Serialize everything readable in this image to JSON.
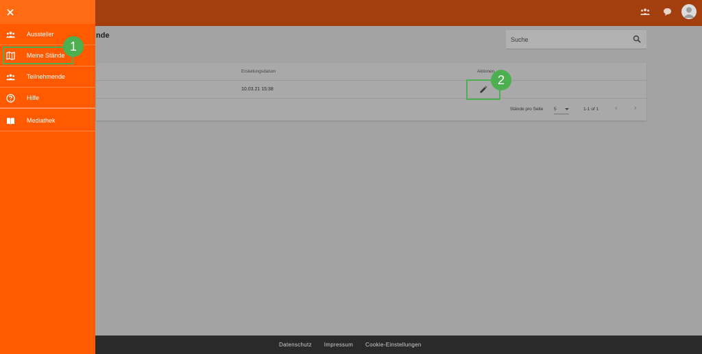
{
  "sidebar": {
    "items": [
      {
        "label": "Aussteller",
        "icon": "people-icon"
      },
      {
        "label": "Meine Stände",
        "icon": "map-icon"
      },
      {
        "label": "Teilnehmende",
        "icon": "people-icon"
      },
      {
        "label": "Hilfe",
        "icon": "help-circle-icon"
      },
      {
        "label": "Mediathek",
        "icon": "book-icon"
      }
    ]
  },
  "page": {
    "title_fragment": "nde"
  },
  "search": {
    "placeholder": "Suche"
  },
  "table": {
    "headers": [
      "Erstellungsdatum",
      "Aktionen"
    ],
    "rows": [
      {
        "date": "10.03.21 15:38"
      }
    ],
    "pager": {
      "per_page_label": "Stände pro Seite",
      "per_page_value": "5",
      "range": "1-1 of 1"
    }
  },
  "annotations": {
    "badge1": "1",
    "badge2": "2"
  },
  "footer": {
    "links": [
      "Datenschutz",
      "Impressum",
      "Cookie-Einstellungen"
    ]
  },
  "colors": {
    "accent": "#ff5a00",
    "topbar": "#a33e0f",
    "highlight": "#4caf50",
    "footer": "#2a2a2a"
  }
}
